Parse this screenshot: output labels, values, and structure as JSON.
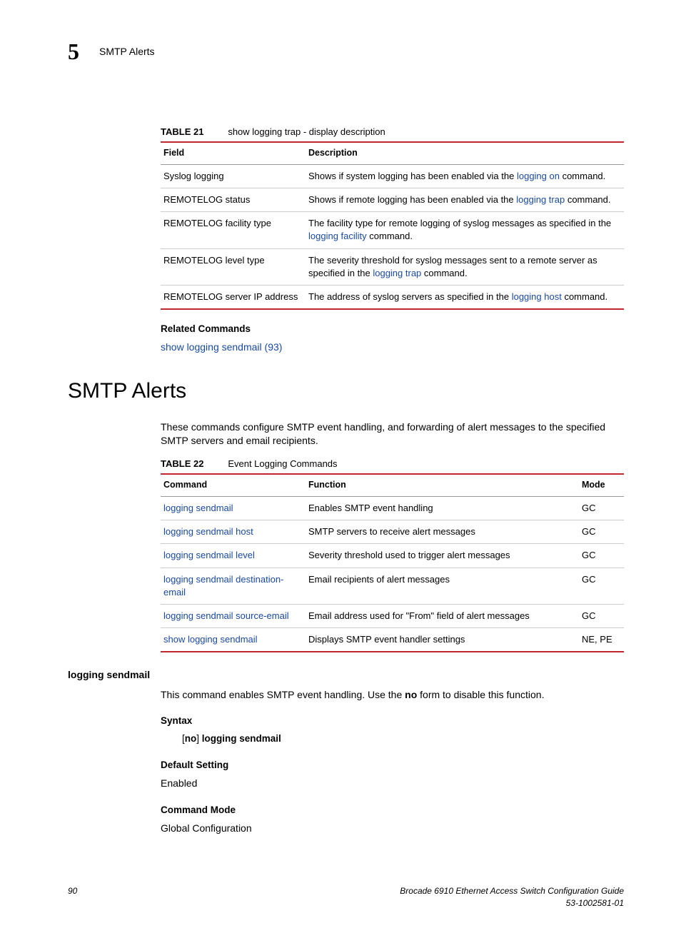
{
  "header": {
    "chapter_number": "5",
    "running_title": "SMTP Alerts"
  },
  "table21": {
    "label": "TABLE 21",
    "title": "show logging trap - display description",
    "headers": {
      "field": "Field",
      "description": "Description"
    },
    "rows": [
      {
        "field": "Syslog logging",
        "desc_pre": "Shows if system logging has been enabled via the ",
        "desc_link": "logging on",
        "desc_post": " command."
      },
      {
        "field": "REMOTELOG status",
        "desc_pre": "Shows if remote logging has been enabled via the ",
        "desc_link": "logging trap",
        "desc_post": " command."
      },
      {
        "field": "REMOTELOG facility type",
        "desc_pre": "The facility type for remote logging of syslog messages as specified in the ",
        "desc_link": "logging facility",
        "desc_post": " command."
      },
      {
        "field": "REMOTELOG level type",
        "desc_pre": "The severity threshold for syslog messages sent to a remote server as specified in the ",
        "desc_link": "logging trap",
        "desc_post": " command."
      },
      {
        "field": "REMOTELOG server IP address",
        "desc_pre": "The address of syslog servers as specified in the ",
        "desc_link": "logging host",
        "desc_post": " command."
      }
    ]
  },
  "related": {
    "heading": "Related Commands",
    "link": "show logging sendmail (93)"
  },
  "section": {
    "title": "SMTP Alerts",
    "intro": "These commands configure SMTP event handling, and forwarding of alert messages to the specified SMTP servers and email recipients."
  },
  "table22": {
    "label": "TABLE 22",
    "title": "Event Logging Commands",
    "headers": {
      "command": "Command",
      "function": "Function",
      "mode": "Mode"
    },
    "rows": [
      {
        "cmd": "logging sendmail",
        "func": "Enables SMTP event handling",
        "mode": "GC"
      },
      {
        "cmd": "logging sendmail host",
        "func": "SMTP servers to receive alert messages",
        "mode": "GC"
      },
      {
        "cmd": "logging sendmail level",
        "func": "Severity threshold used to trigger alert messages",
        "mode": "GC"
      },
      {
        "cmd": "logging sendmail destination- email",
        "func": "Email recipients of alert messages",
        "mode": "GC"
      },
      {
        "cmd": "logging sendmail source-email",
        "func": "Email address used for \"From\" field of alert messages",
        "mode": "GC"
      },
      {
        "cmd": "show logging sendmail",
        "func": "Displays SMTP event handler settings",
        "mode": "NE, PE"
      }
    ]
  },
  "cmd_detail": {
    "name": "logging sendmail",
    "desc_pre": "This command enables SMTP event handling. Use the ",
    "desc_bold": "no",
    "desc_post": " form to disable this function.",
    "syntax_heading": "Syntax",
    "syntax_open": "[",
    "syntax_no": "no",
    "syntax_close": "] ",
    "syntax_cmd": "logging sendmail",
    "default_heading": "Default Setting",
    "default_value": "Enabled",
    "mode_heading": "Command Mode",
    "mode_value": "Global Configuration"
  },
  "footer": {
    "page": "90",
    "book": "Brocade 6910 Ethernet Access Switch Configuration Guide",
    "docnum": "53-1002581-01"
  }
}
